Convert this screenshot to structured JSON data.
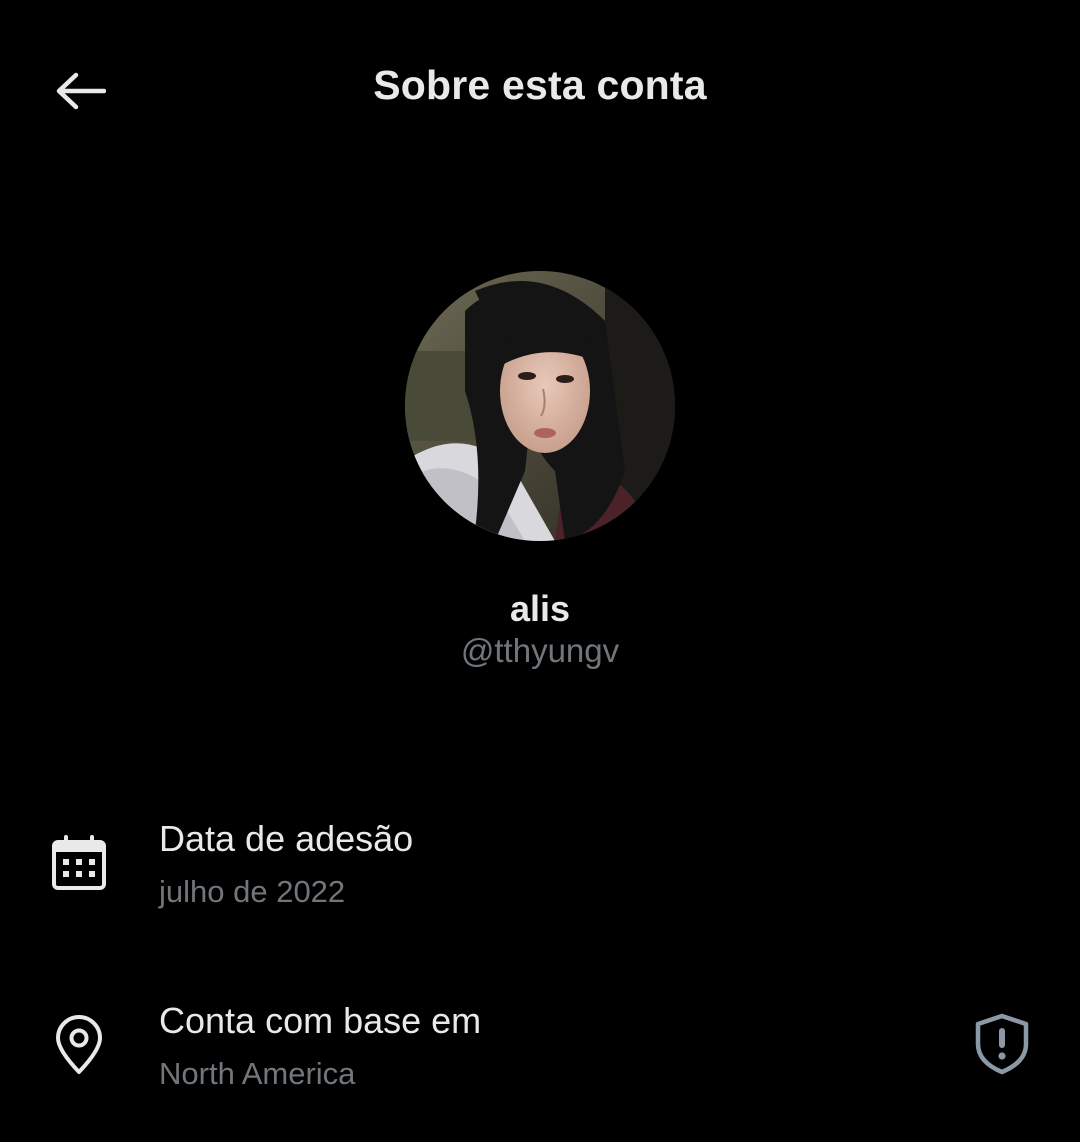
{
  "header": {
    "title": "Sobre esta conta",
    "back_icon": "arrow-left-icon"
  },
  "profile": {
    "display_name": "alis",
    "handle": "@tthyungv",
    "avatar_description_icon": "profile-photo"
  },
  "details": [
    {
      "icon": "calendar-icon",
      "label": "Data de adesão",
      "value": "julho de 2022"
    },
    {
      "icon": "location-pin-icon",
      "label": "Conta com base em",
      "value": "North America",
      "action_icon": "shield-alert-icon"
    }
  ],
  "colors": {
    "background": "#000000",
    "primary_text": "#e7e9ea",
    "secondary_text": "#71767b"
  }
}
